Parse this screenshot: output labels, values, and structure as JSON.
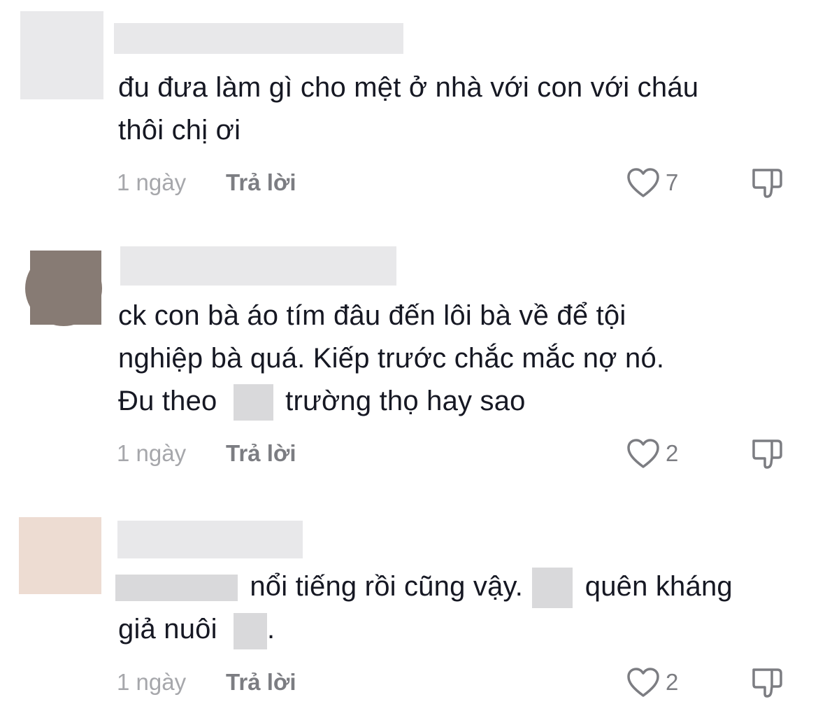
{
  "comments": [
    {
      "text_parts": [
        "đu đưa làm gì cho mệt ở nhà với con với cháu",
        "thôi chị ơi"
      ],
      "time": "1 ngày",
      "reply_label": "Trả lời",
      "likes": "7",
      "avatar_color": "#e9e9eb"
    },
    {
      "line1": "ck con bà áo tím đâu đến lôi bà về để tội",
      "line2": "nghiệp bà quá. Kiếp trước chắc mắc nợ nó.",
      "line3_a": "Đu theo",
      "line3_b": "trường thọ hay sao",
      "time": "1 ngày",
      "reply_label": "Trả lời",
      "likes": "2",
      "avatar_color": "#877b74"
    },
    {
      "line1_b": "nổi tiếng rồi cũng vậy.",
      "line1_c": "quên kháng",
      "line2_a": "giả nuôi",
      "line2_b": ".",
      "time": "1 ngày",
      "reply_label": "Trả lời",
      "likes": "2",
      "avatar_color": "#eddcd2"
    }
  ],
  "icons": {
    "like": "heart-outline-icon",
    "dislike": "thumbs-down-icon"
  }
}
